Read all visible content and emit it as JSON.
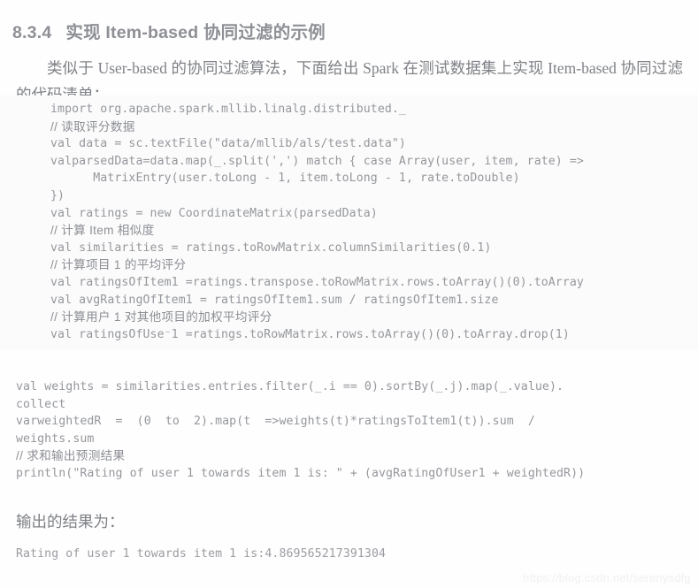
{
  "heading": {
    "number": "8.3.4",
    "title": "实现 Item-based 协同过滤的示例"
  },
  "paragraph": {
    "text": "类似于 User-based 的协同过滤算法，下面给出 Spark 在测试数据集上实现 Item-based 协同过滤的代码清单："
  },
  "code_block_main": {
    "lines": [
      {
        "kind": "code",
        "text": "import org.apache.spark.mllib.linalg.distributed._"
      },
      {
        "kind": "comment",
        "text": "// 读取评分数据"
      },
      {
        "kind": "code",
        "text": "val data = sc.textFile(\"data/mllib/als/test.data\")"
      },
      {
        "kind": "code",
        "text": "valparsedData=data.map(_.split(',') match { case Array(user, item, rate) =>"
      },
      {
        "kind": "code",
        "text": "      MatrixEntry(user.toLong - 1, item.toLong - 1, rate.toDouble)"
      },
      {
        "kind": "code",
        "text": "})"
      },
      {
        "kind": "code",
        "text": "val ratings = new CoordinateMatrix(parsedData)"
      },
      {
        "kind": "comment",
        "text": "// 计算 Item 相似度"
      },
      {
        "kind": "code",
        "text": "val similarities = ratings.toRowMatrix.columnSimilarities(0.1)"
      },
      {
        "kind": "comment",
        "text": "// 计算项目 1 的平均评分"
      },
      {
        "kind": "code",
        "text": "val ratingsOfItem1 =ratings.transpose.toRowMatrix.rows.toArray()(0).toArray"
      },
      {
        "kind": "code",
        "text": "val avgRatingOfItem1 = ratingsOfItem1.sum / ratingsOfItem1.size"
      },
      {
        "kind": "comment",
        "text": "// 计算用户 1 对其他项目的加权平均评分"
      },
      {
        "kind": "code",
        "text": "val ratingsOfUse⁻1 =ratings.toRowMatrix.rows.toArray()(0).toArray.drop(1)"
      }
    ]
  },
  "code_block_secondary": {
    "lines": [
      {
        "kind": "code",
        "text": "val weights = similarities.entries.filter(_.i == 0).sortBy(_.j).map(_.value)."
      },
      {
        "kind": "code",
        "text": "collect"
      },
      {
        "kind": "code",
        "text": "varweightedR  =  (0  to  2).map(t  =>weights(t)*ratingsToItem1(t)).sum  /"
      },
      {
        "kind": "code",
        "text": "weights.sum"
      },
      {
        "kind": "comment",
        "text": "// 求和输出预测结果"
      },
      {
        "kind": "code",
        "text": "println(\"Rating of user 1 towards item 1 is: \" + (avgRatingOfUser1 + weightedR))"
      }
    ]
  },
  "output": {
    "label": "输出的结果为：",
    "result": "Rating of user 1 towards item 1 is:4.869565217391304"
  },
  "watermark": {
    "text": "https://blog.csdn.net/serenysdfg"
  },
  "colors": {
    "page_background": "#fefefe",
    "code_background": "#fbfbfb",
    "body_text": "#7f8186",
    "code_text": "#95979c",
    "heading_text": "#8e9095",
    "watermark_text": "#f0f0f0"
  }
}
